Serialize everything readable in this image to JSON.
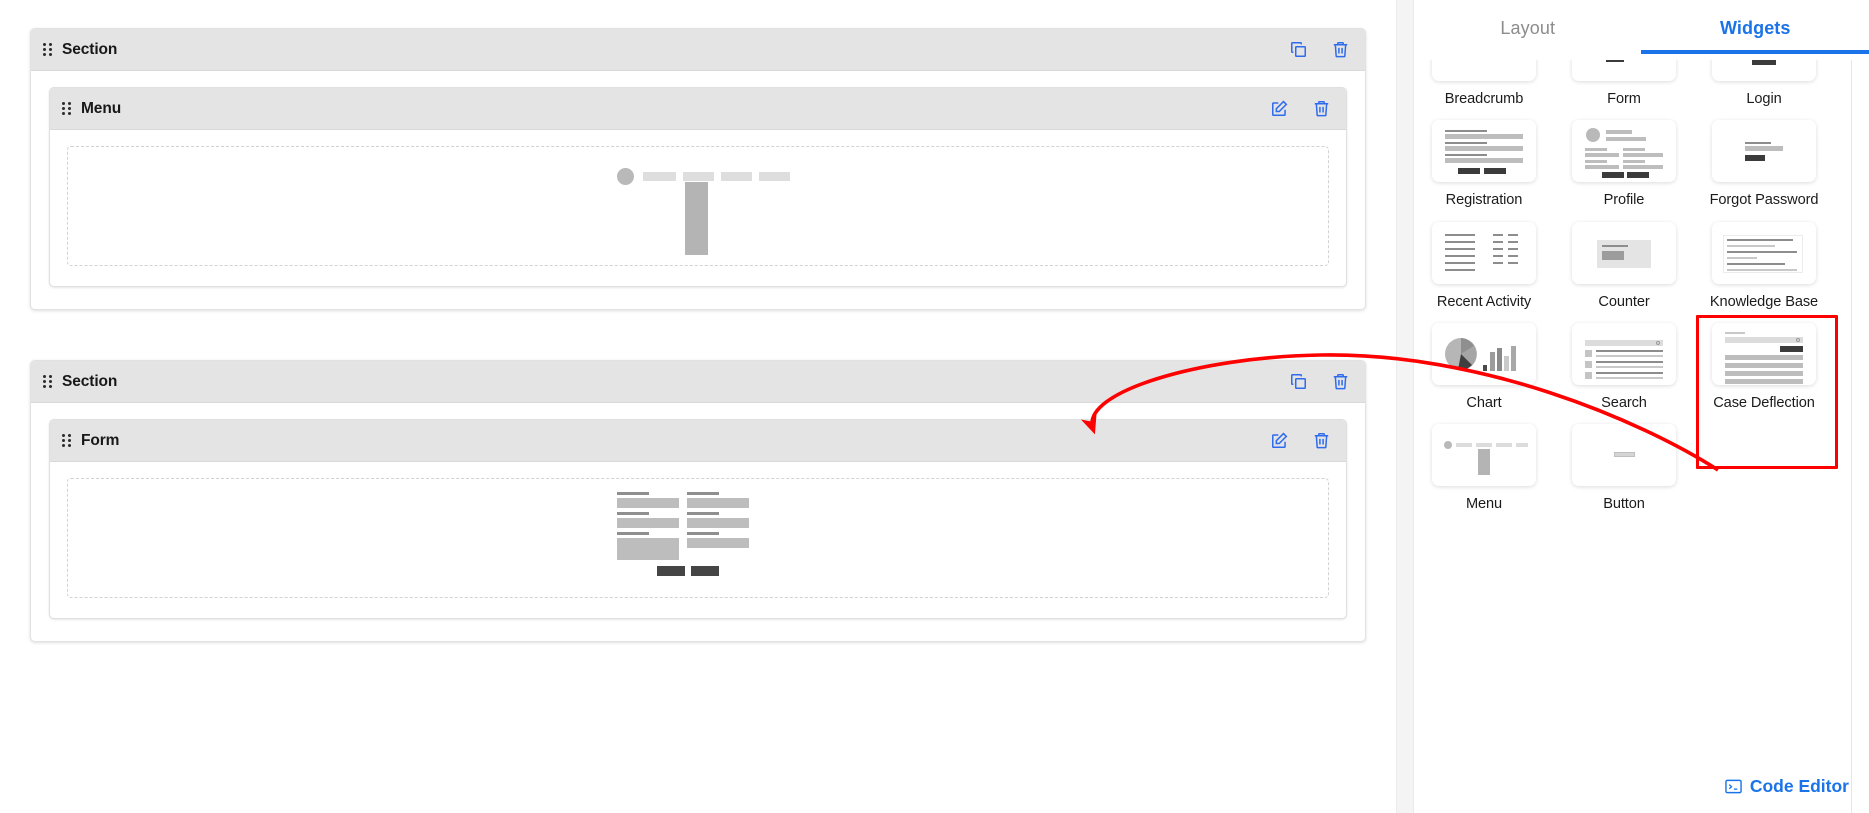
{
  "canvas": {
    "sections": [
      {
        "title": "Section",
        "actions": [
          {
            "name": "duplicate-icon",
            "label": "Duplicate"
          },
          {
            "name": "delete-icon",
            "label": "Delete"
          }
        ],
        "widget": {
          "title": "Menu",
          "actions": [
            {
              "name": "edit-icon",
              "label": "Edit"
            },
            {
              "name": "delete-icon",
              "label": "Delete"
            }
          ],
          "preview": "menu-skeleton"
        }
      },
      {
        "title": "Section",
        "actions": [
          {
            "name": "duplicate-icon",
            "label": "Duplicate"
          },
          {
            "name": "delete-icon",
            "label": "Delete"
          }
        ],
        "widget": {
          "title": "Form",
          "actions": [
            {
              "name": "edit-icon",
              "label": "Edit"
            },
            {
              "name": "delete-icon",
              "label": "Delete"
            }
          ],
          "preview": "form-skeleton"
        }
      }
    ]
  },
  "panel": {
    "tabs": [
      {
        "label": "Layout",
        "active": false
      },
      {
        "label": "Widgets",
        "active": true
      }
    ],
    "widgets": [
      {
        "label": "Breadcrumb",
        "icon": "breadcrumb-thumb",
        "selected": false
      },
      {
        "label": "Form",
        "icon": "form-thumb",
        "selected": false
      },
      {
        "label": "Login",
        "icon": "login-thumb",
        "selected": false
      },
      {
        "label": "Registration",
        "icon": "registration-thumb",
        "selected": false
      },
      {
        "label": "Profile",
        "icon": "profile-thumb",
        "selected": false
      },
      {
        "label": "Forgot Password",
        "icon": "forgot-password-thumb",
        "selected": false
      },
      {
        "label": "Recent Activity",
        "icon": "recent-activity-thumb",
        "selected": false
      },
      {
        "label": "Counter",
        "icon": "counter-thumb",
        "selected": false
      },
      {
        "label": "Knowledge Base",
        "icon": "knowledge-base-thumb",
        "selected": false
      },
      {
        "label": "Chart",
        "icon": "chart-thumb",
        "selected": false
      },
      {
        "label": "Search",
        "icon": "search-thumb",
        "selected": false
      },
      {
        "label": "Case Deflection",
        "icon": "case-deflection-thumb",
        "selected": true
      },
      {
        "label": "Menu",
        "icon": "menu-thumb",
        "selected": false
      },
      {
        "label": "Button",
        "icon": "button-thumb",
        "selected": false
      }
    ],
    "code_editor": {
      "label": "Code Editor",
      "icon": "terminal-icon"
    }
  },
  "annotation": {
    "arrow_color": "#fe0000",
    "highlight_color": "#fe0000",
    "from": "Case Deflection widget",
    "to": "Section header"
  },
  "colors": {
    "accent": "#1a73e8",
    "header_bg": "#e4e4e4",
    "annotation": "#fe0000"
  }
}
